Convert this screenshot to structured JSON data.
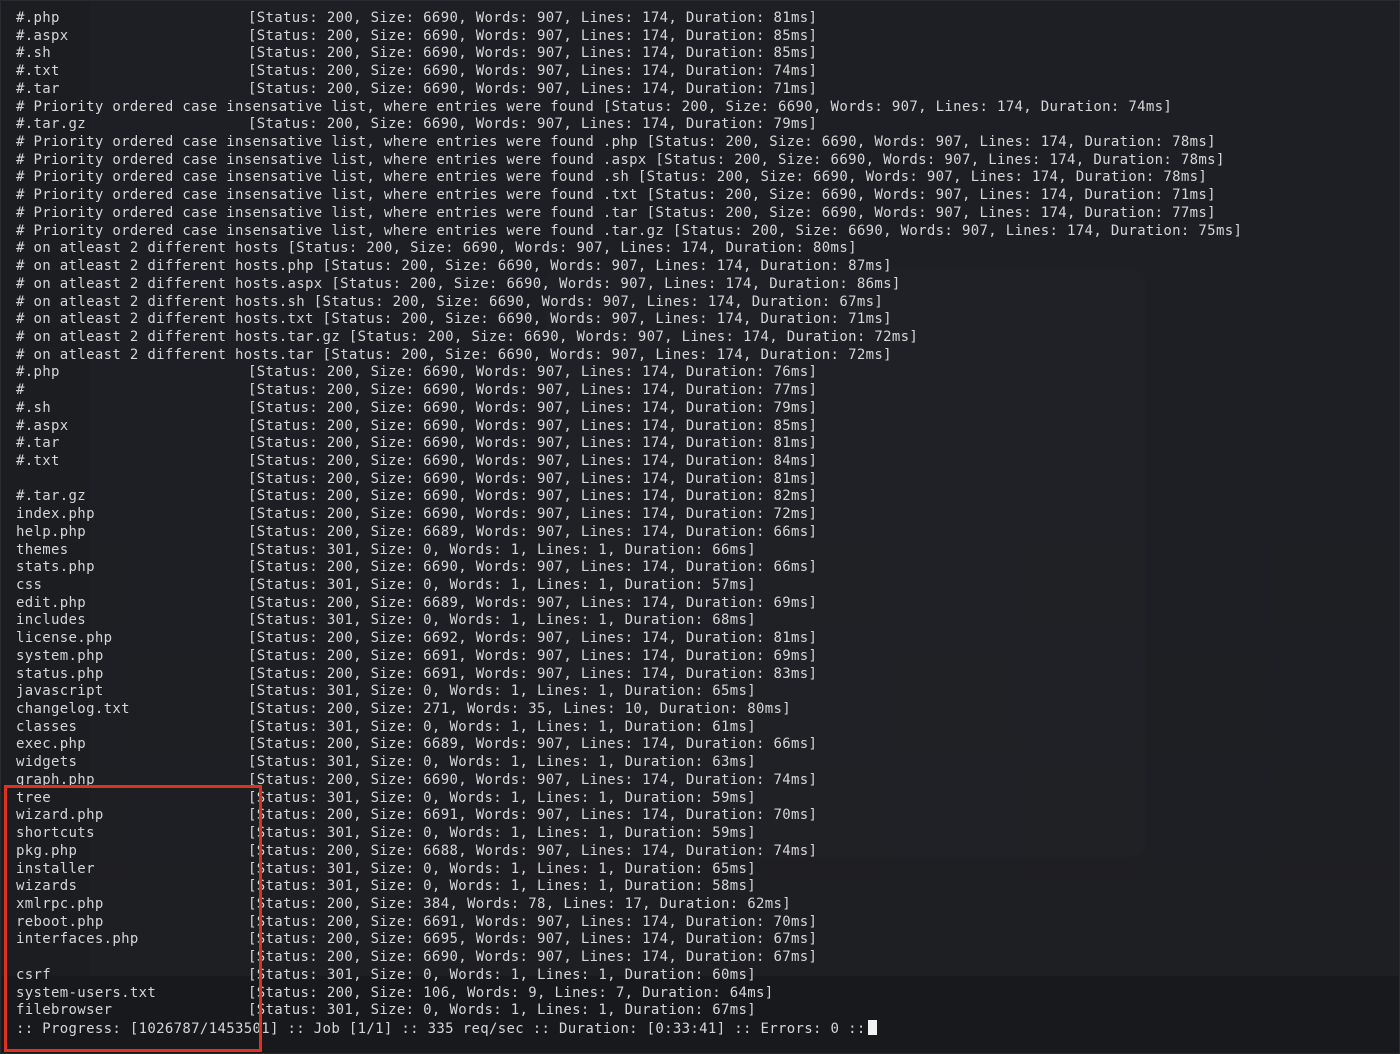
{
  "terminal": {
    "rows": [
      {
        "name": "#.php",
        "result": "[Status: 200, Size: 6690, Words: 907, Lines: 174, Duration: 81ms]"
      },
      {
        "name": "#.aspx",
        "result": "[Status: 200, Size: 6690, Words: 907, Lines: 174, Duration: 85ms]"
      },
      {
        "name": "#.sh",
        "result": "[Status: 200, Size: 6690, Words: 907, Lines: 174, Duration: 85ms]"
      },
      {
        "name": "#.txt",
        "result": "[Status: 200, Size: 6690, Words: 907, Lines: 174, Duration: 74ms]"
      },
      {
        "name": "#.tar",
        "result": "[Status: 200, Size: 6690, Words: 907, Lines: 174, Duration: 71ms]"
      },
      {
        "text": "# Priority ordered case insensative list, where entries were found [Status: 200, Size: 6690, Words: 907, Lines: 174, Duration: 74ms]"
      },
      {
        "name": "#.tar.gz",
        "result": "[Status: 200, Size: 6690, Words: 907, Lines: 174, Duration: 79ms]"
      },
      {
        "text": "# Priority ordered case insensative list, where entries were found .php [Status: 200, Size: 6690, Words: 907, Lines: 174, Duration: 78ms]"
      },
      {
        "text": "# Priority ordered case insensative list, where entries were found .aspx [Status: 200, Size: 6690, Words: 907, Lines: 174, Duration: 78ms]"
      },
      {
        "text": "# Priority ordered case insensative list, where entries were found .sh [Status: 200, Size: 6690, Words: 907, Lines: 174, Duration: 78ms]"
      },
      {
        "text": "# Priority ordered case insensative list, where entries were found .txt [Status: 200, Size: 6690, Words: 907, Lines: 174, Duration: 71ms]"
      },
      {
        "text": "# Priority ordered case insensative list, where entries were found .tar [Status: 200, Size: 6690, Words: 907, Lines: 174, Duration: 77ms]"
      },
      {
        "text": "# Priority ordered case insensative list, where entries were found .tar.gz [Status: 200, Size: 6690, Words: 907, Lines: 174, Duration: 75ms]"
      },
      {
        "text": "# on atleast 2 different hosts [Status: 200, Size: 6690, Words: 907, Lines: 174, Duration: 80ms]"
      },
      {
        "text": "# on atleast 2 different hosts.php [Status: 200, Size: 6690, Words: 907, Lines: 174, Duration: 87ms]"
      },
      {
        "text": "# on atleast 2 different hosts.aspx [Status: 200, Size: 6690, Words: 907, Lines: 174, Duration: 86ms]"
      },
      {
        "text": "# on atleast 2 different hosts.sh [Status: 200, Size: 6690, Words: 907, Lines: 174, Duration: 67ms]"
      },
      {
        "text": "# on atleast 2 different hosts.txt [Status: 200, Size: 6690, Words: 907, Lines: 174, Duration: 71ms]"
      },
      {
        "text": "# on atleast 2 different hosts.tar.gz [Status: 200, Size: 6690, Words: 907, Lines: 174, Duration: 72ms]"
      },
      {
        "text": "# on atleast 2 different hosts.tar [Status: 200, Size: 6690, Words: 907, Lines: 174, Duration: 72ms]"
      },
      {
        "name": "#.php",
        "result": "[Status: 200, Size: 6690, Words: 907, Lines: 174, Duration: 76ms]"
      },
      {
        "name": "#",
        "result": "[Status: 200, Size: 6690, Words: 907, Lines: 174, Duration: 77ms]"
      },
      {
        "name": "#.sh",
        "result": "[Status: 200, Size: 6690, Words: 907, Lines: 174, Duration: 79ms]"
      },
      {
        "name": "#.aspx",
        "result": "[Status: 200, Size: 6690, Words: 907, Lines: 174, Duration: 85ms]"
      },
      {
        "name": "#.tar",
        "result": "[Status: 200, Size: 6690, Words: 907, Lines: 174, Duration: 81ms]"
      },
      {
        "name": "#.txt",
        "result": "[Status: 200, Size: 6690, Words: 907, Lines: 174, Duration: 84ms]"
      },
      {
        "name": "",
        "result": "[Status: 200, Size: 6690, Words: 907, Lines: 174, Duration: 81ms]"
      },
      {
        "name": "#.tar.gz",
        "result": "[Status: 200, Size: 6690, Words: 907, Lines: 174, Duration: 82ms]"
      },
      {
        "name": "index.php",
        "result": "[Status: 200, Size: 6690, Words: 907, Lines: 174, Duration: 72ms]"
      },
      {
        "name": "help.php",
        "result": "[Status: 200, Size: 6689, Words: 907, Lines: 174, Duration: 66ms]"
      },
      {
        "name": "themes",
        "result": "[Status: 301, Size: 0, Words: 1, Lines: 1, Duration: 66ms]"
      },
      {
        "name": "stats.php",
        "result": "[Status: 200, Size: 6690, Words: 907, Lines: 174, Duration: 66ms]"
      },
      {
        "name": "css",
        "result": "[Status: 301, Size: 0, Words: 1, Lines: 1, Duration: 57ms]"
      },
      {
        "name": "edit.php",
        "result": "[Status: 200, Size: 6689, Words: 907, Lines: 174, Duration: 69ms]"
      },
      {
        "name": "includes",
        "result": "[Status: 301, Size: 0, Words: 1, Lines: 1, Duration: 68ms]"
      },
      {
        "name": "license.php",
        "result": "[Status: 200, Size: 6692, Words: 907, Lines: 174, Duration: 81ms]"
      },
      {
        "name": "system.php",
        "result": "[Status: 200, Size: 6691, Words: 907, Lines: 174, Duration: 69ms]"
      },
      {
        "name": "status.php",
        "result": "[Status: 200, Size: 6691, Words: 907, Lines: 174, Duration: 83ms]"
      },
      {
        "name": "javascript",
        "result": "[Status: 301, Size: 0, Words: 1, Lines: 1, Duration: 65ms]"
      },
      {
        "name": "changelog.txt",
        "result": "[Status: 200, Size: 271, Words: 35, Lines: 10, Duration: 80ms]"
      },
      {
        "name": "classes",
        "result": "[Status: 301, Size: 0, Words: 1, Lines: 1, Duration: 61ms]"
      },
      {
        "name": "exec.php",
        "result": "[Status: 200, Size: 6689, Words: 907, Lines: 174, Duration: 66ms]"
      },
      {
        "name": "widgets",
        "result": "[Status: 301, Size: 0, Words: 1, Lines: 1, Duration: 63ms]"
      },
      {
        "name": "graph.php",
        "result": "[Status: 200, Size: 6690, Words: 907, Lines: 174, Duration: 74ms]"
      },
      {
        "name": "tree",
        "result": "[Status: 301, Size: 0, Words: 1, Lines: 1, Duration: 59ms]"
      },
      {
        "name": "wizard.php",
        "result": "[Status: 200, Size: 6691, Words: 907, Lines: 174, Duration: 70ms]"
      },
      {
        "name": "shortcuts",
        "result": "[Status: 301, Size: 0, Words: 1, Lines: 1, Duration: 59ms]"
      },
      {
        "name": "pkg.php",
        "result": "[Status: 200, Size: 6688, Words: 907, Lines: 174, Duration: 74ms]"
      },
      {
        "name": "installer",
        "result": "[Status: 301, Size: 0, Words: 1, Lines: 1, Duration: 65ms]"
      },
      {
        "name": "wizards",
        "result": "[Status: 301, Size: 0, Words: 1, Lines: 1, Duration: 58ms]"
      },
      {
        "name": "xmlrpc.php",
        "result": "[Status: 200, Size: 384, Words: 78, Lines: 17, Duration: 62ms]"
      },
      {
        "name": "reboot.php",
        "result": "[Status: 200, Size: 6691, Words: 907, Lines: 174, Duration: 70ms]"
      },
      {
        "name": "interfaces.php",
        "result": "[Status: 200, Size: 6695, Words: 907, Lines: 174, Duration: 67ms]"
      },
      {
        "name": "",
        "result": "[Status: 200, Size: 6690, Words: 907, Lines: 174, Duration: 67ms]"
      },
      {
        "name": "csrf",
        "result": "[Status: 301, Size: 0, Words: 1, Lines: 1, Duration: 60ms]"
      },
      {
        "name": "system-users.txt",
        "result": "[Status: 200, Size: 106, Words: 9, Lines: 7, Duration: 64ms]"
      },
      {
        "name": "filebrowser",
        "result": "[Status: 301, Size: 0, Words: 1, Lines: 1, Duration: 67ms]"
      }
    ],
    "progress": ":: Progress: [1026787/1453501] :: Job [1/1] :: 335 req/sec :: Duration: [0:33:41] :: Errors: 0 ::"
  },
  "colors": {
    "background": "#1c1d21",
    "text": "#d6d6d6",
    "highlight": "#e0311f",
    "cursor": "#f2f2f2"
  }
}
